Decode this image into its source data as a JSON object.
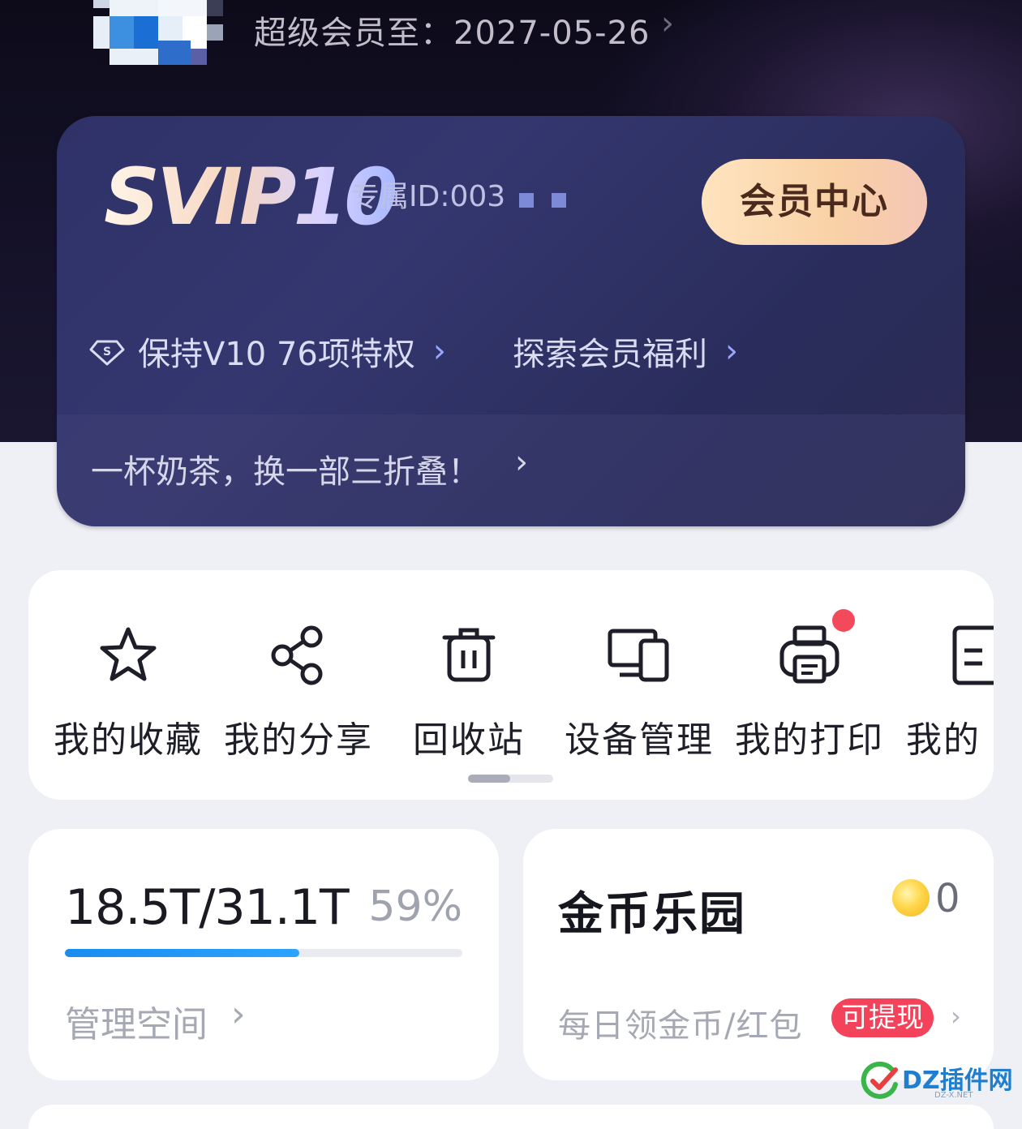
{
  "header": {
    "expiry_text": "超级会员至：2027-05-26",
    "expiry_chevron": "›"
  },
  "vip_card": {
    "level_logo": "SVIP10",
    "member_id": "专属ID:003",
    "member_center_label": "会员中心",
    "privilege_text": "保持V10 76项特权",
    "explore_text": "探索会员福利",
    "chevron": "›",
    "promo_text": "一杯奶茶，换一部三折叠！",
    "colors": {
      "card": "#2f3268",
      "button": "#ffe4bf"
    }
  },
  "tools": {
    "items": [
      {
        "label": "我的收藏",
        "icon": "star-icon"
      },
      {
        "label": "我的分享",
        "icon": "share-icon"
      },
      {
        "label": "回收站",
        "icon": "trash-icon"
      },
      {
        "label": "设备管理",
        "icon": "devices-icon"
      },
      {
        "label": "我的打印",
        "icon": "printer-icon",
        "has_notification": true
      },
      {
        "label": "我的",
        "icon": "document-icon"
      }
    ],
    "scroll_position": 0.5
  },
  "storage": {
    "amount": "18.5T/31.1T",
    "percent": "59%",
    "used_fraction": 0.59,
    "manage_label": "管理空间",
    "chevron": "›",
    "accent_color": "#1a8cf0"
  },
  "coins": {
    "title": "金币乐园",
    "count": "0",
    "daily_text": "每日领金币/红包",
    "badge": "可提现",
    "chevron": "›",
    "badge_color": "#f4425a"
  },
  "watermark": {
    "text": "DZ插件网",
    "sub": "DZ-X.NET"
  }
}
